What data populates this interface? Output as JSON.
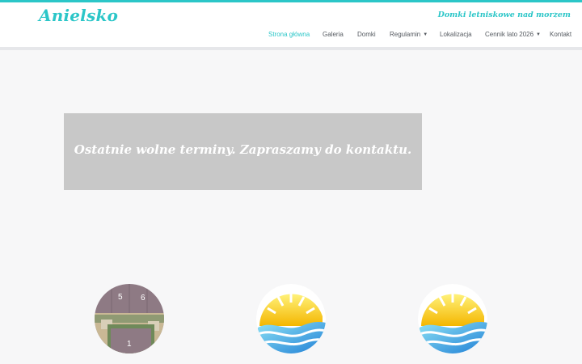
{
  "brand": {
    "logo": "Anielsko",
    "tagline": "Domki letniskowe nad morzem",
    "accent_color": "#2bc6c8"
  },
  "nav": {
    "items": [
      {
        "label": "Strona główna",
        "active": true,
        "dropdown": false
      },
      {
        "label": "Galeria",
        "active": false,
        "dropdown": false
      },
      {
        "label": "Domki",
        "active": false,
        "dropdown": false
      },
      {
        "label": "Regulamin",
        "active": false,
        "dropdown": true
      },
      {
        "label": "Lokalizacja",
        "active": false,
        "dropdown": false
      },
      {
        "label": "Cennik lato 2026",
        "active": false,
        "dropdown": true
      },
      {
        "label": "Kontakt",
        "active": false,
        "dropdown": false
      }
    ]
  },
  "banner": {
    "text": "Ostatnie wolne terminy. Zapraszamy do kontaktu."
  },
  "features": [
    {
      "icon": "cabin-plan-image",
      "labels": [
        "5",
        "6",
        "1"
      ]
    },
    {
      "icon": "sun-sea-icon"
    },
    {
      "icon": "sun-sea-icon"
    }
  ]
}
